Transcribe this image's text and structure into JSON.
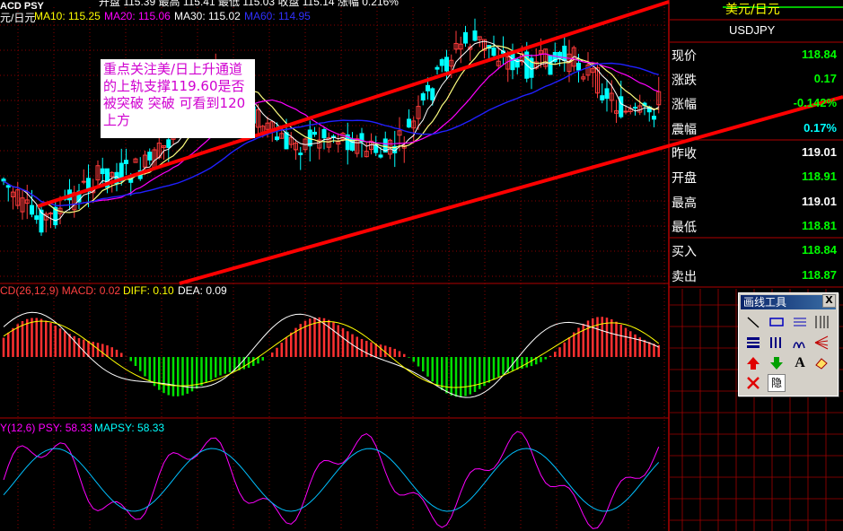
{
  "chart_header": {
    "title": "元/日元",
    "ma10": "MA10: 115.25",
    "ma20": "MA20: 115.06",
    "ma30": "MA30: 115.02",
    "ma60": "MA60: 114.95",
    "top_strip": "开盘    115.39 最高    115.41 最低    115.03 收盘    115.14 涨幅  0.216%",
    "corner": "ACD PSY"
  },
  "macd_header": {
    "label": "CD(26,12,9) MACD: 0.02",
    "diff": "DIFF: 0.10",
    "dea": "DEA: 0.09"
  },
  "psy_header": {
    "label": "Y(12,6) PSY: 58.33",
    "mapsy": "MAPSY: 58.33"
  },
  "annotation": {
    "text": "重点关注美/日上升通道的上轨支撑119.60是否被突破 突破 可看到120上方"
  },
  "quote_panel": {
    "title": "美元/日元",
    "symbol": "USDJPY",
    "rows": [
      {
        "label": "现价",
        "value": "118.84",
        "color": "#00ff00"
      },
      {
        "label": "涨跌",
        "value": "0.17",
        "color": "#00ff00"
      },
      {
        "label": "涨幅",
        "value": "-0.142%",
        "color": "#00ff00"
      },
      {
        "label": "震幅",
        "value": "0.17%",
        "color": "#00ffff"
      },
      {
        "label": "昨收",
        "value": "119.01",
        "color": "#ffffff"
      },
      {
        "label": "开盘",
        "value": "118.91",
        "color": "#00ff00"
      },
      {
        "label": "最高",
        "value": "119.01",
        "color": "#ffffff"
      },
      {
        "label": "最低",
        "value": "118.81",
        "color": "#00ff00"
      },
      {
        "label": "买入",
        "value": "118.84",
        "color": "#00ff00"
      },
      {
        "label": "卖出",
        "value": "118.87",
        "color": "#00ff00"
      }
    ]
  },
  "toolbox": {
    "title": "画线工具",
    "close": "X",
    "hide_label": "隐",
    "text_tool": "A",
    "tools": [
      "line-tool-icon",
      "rect-tool-icon",
      "parallel-lines-icon",
      "fib-lines-icon",
      "gann-icon",
      "bars-icon",
      "cycle-icon",
      "fan-icon",
      "up-arrow-icon",
      "down-arrow-icon",
      "text-icon",
      "eraser-icon",
      "delete-icon",
      "hide-icon"
    ]
  },
  "colors": {
    "grid": "#8b0000",
    "trend": "#ff0000",
    "up": "#ff3b3b",
    "down": "#00ffff",
    "ma10": "#ffff80",
    "ma20": "#ff00ff",
    "ma60": "#2020ff"
  }
}
